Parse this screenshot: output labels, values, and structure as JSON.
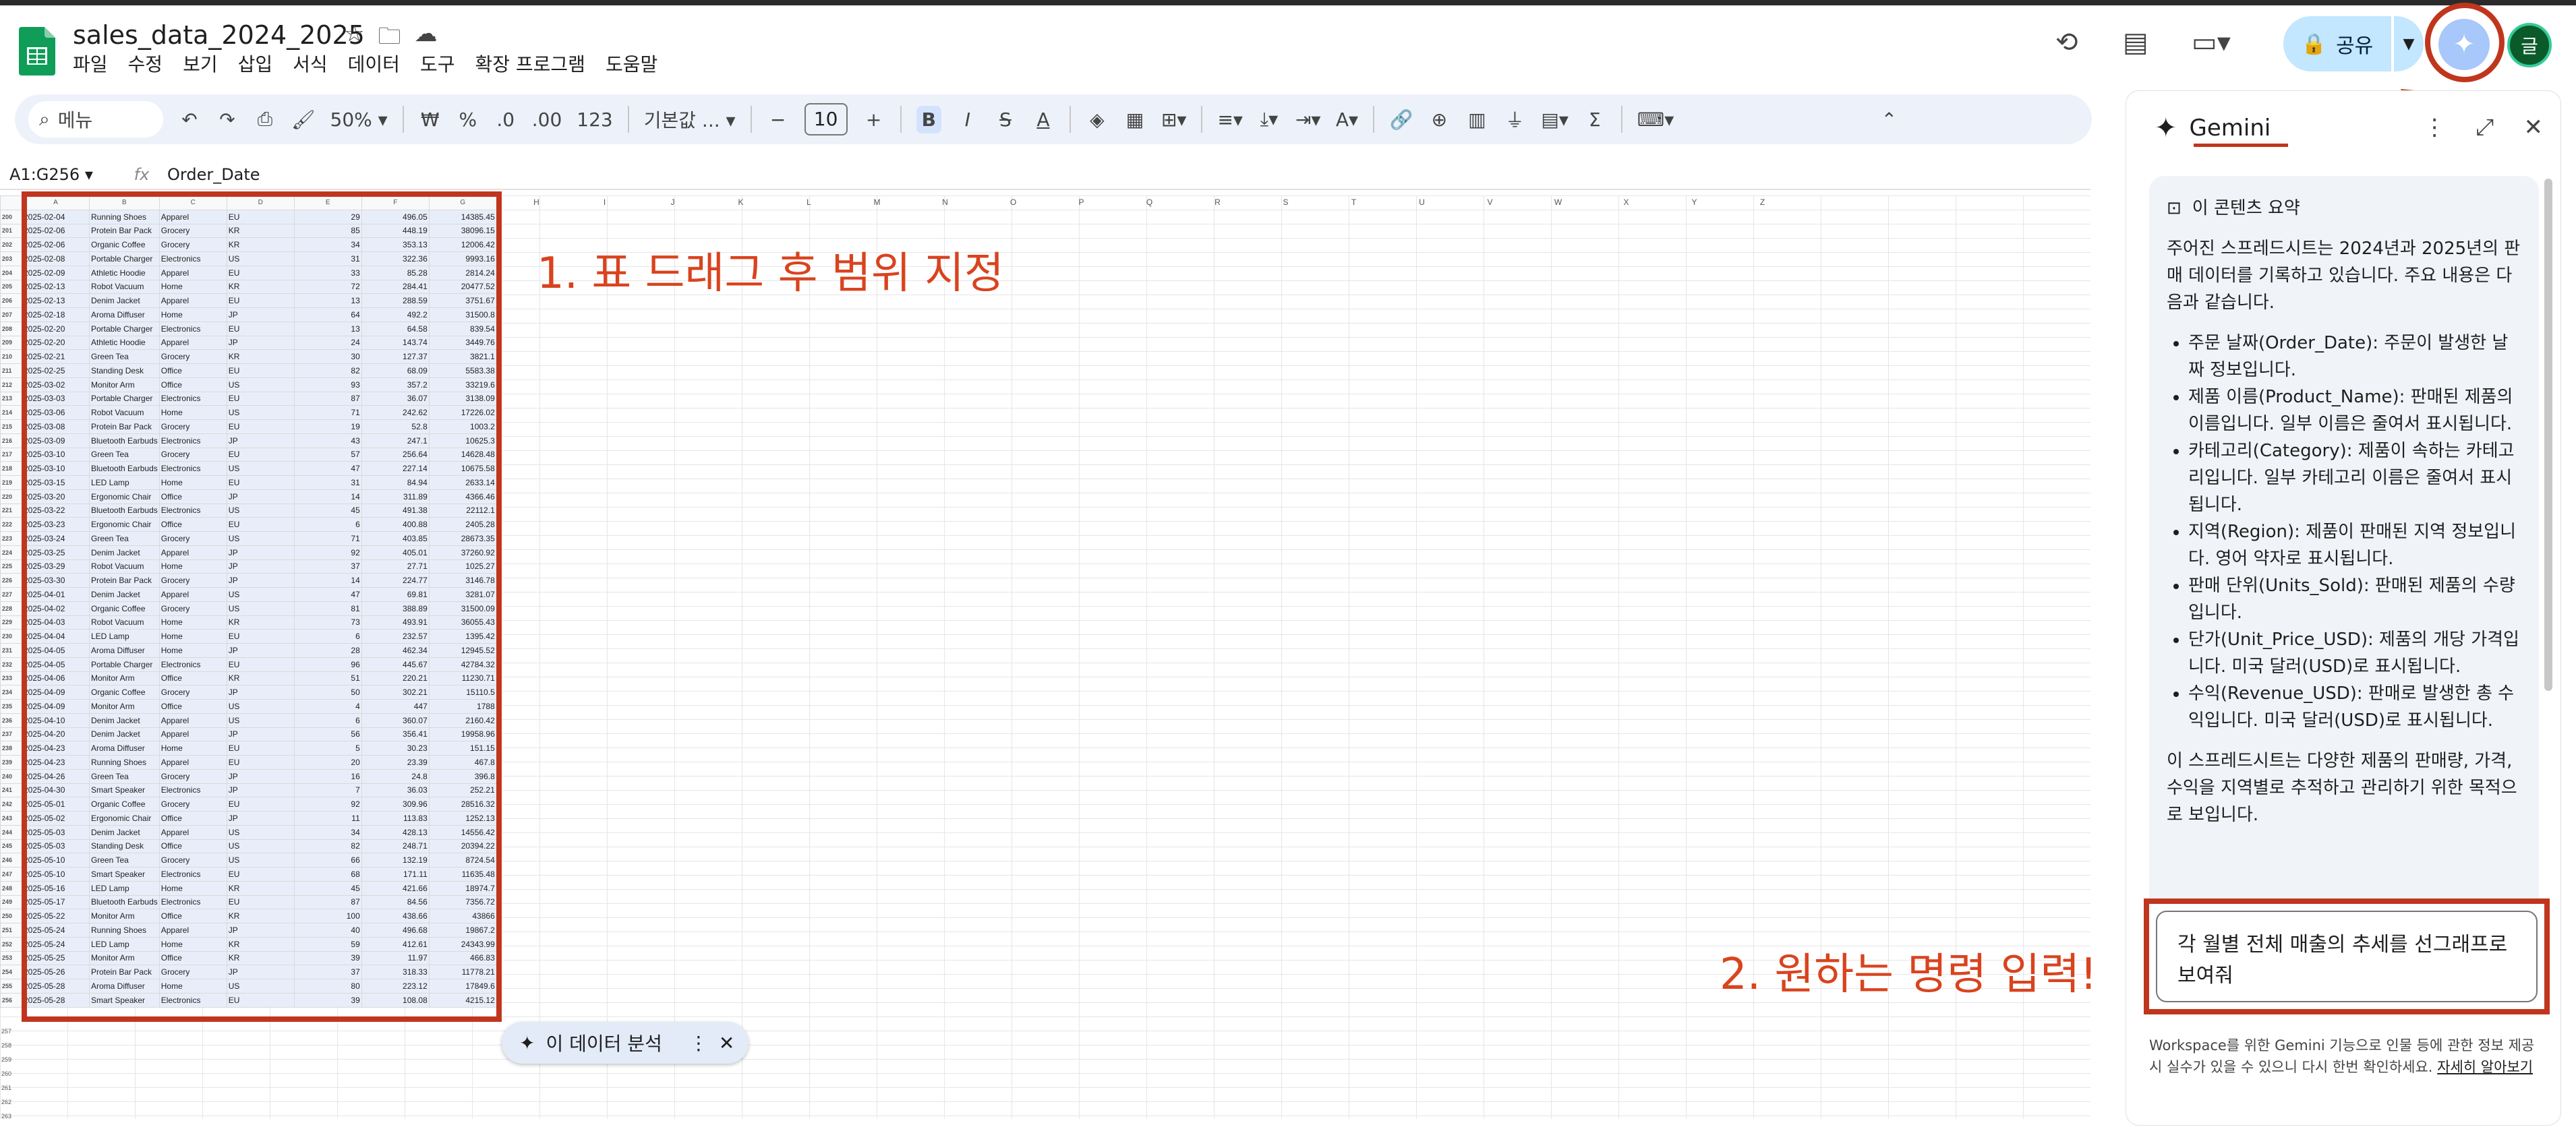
{
  "doc": {
    "title": "sales_data_2024_2025"
  },
  "menu": [
    "파일",
    "수정",
    "보기",
    "삽입",
    "서식",
    "데이터",
    "도구",
    "확장 프로그램",
    "도움말"
  ],
  "header": {
    "share_label": "공유",
    "avatar_letter": "글"
  },
  "toolbar": {
    "search_placeholder": "메뉴",
    "zoom": "50%",
    "currency": "₩",
    "percent": "%",
    "dec_less": ".0",
    "dec_more": ".00",
    "number_fmt": "123",
    "font": "기본값 ...",
    "font_size": "10",
    "minus": "−",
    "plus": "+",
    "bold": "B",
    "italic": "I",
    "strike": "S",
    "textcolor": "A"
  },
  "formula": {
    "range": "A1:G256",
    "fx": "fx",
    "value": "Order_Date"
  },
  "columns": [
    "A",
    "B",
    "C",
    "D",
    "E",
    "F",
    "G"
  ],
  "empty_columns": [
    "H",
    "I",
    "J",
    "K",
    "L",
    "M",
    "N",
    "O",
    "P",
    "Q",
    "R",
    "S",
    "T",
    "U",
    "V",
    "W",
    "X",
    "Y",
    "Z"
  ],
  "rows": [
    [
      "200",
      "2025-02-04",
      "Running Shoes",
      "Apparel",
      "EU",
      "29",
      "496.05",
      "14385.45"
    ],
    [
      "201",
      "2025-02-06",
      "Protein Bar Pack",
      "Grocery",
      "KR",
      "85",
      "448.19",
      "38096.15"
    ],
    [
      "202",
      "2025-02-06",
      "Organic Coffee",
      "Grocery",
      "KR",
      "34",
      "353.13",
      "12006.42"
    ],
    [
      "203",
      "2025-02-08",
      "Portable Charger",
      "Electronics",
      "US",
      "31",
      "322.36",
      "9993.16"
    ],
    [
      "204",
      "2025-02-09",
      "Athletic Hoodie",
      "Apparel",
      "EU",
      "33",
      "85.28",
      "2814.24"
    ],
    [
      "205",
      "2025-02-13",
      "Robot Vacuum",
      "Home",
      "KR",
      "72",
      "284.41",
      "20477.52"
    ],
    [
      "206",
      "2025-02-13",
      "Denim Jacket",
      "Apparel",
      "EU",
      "13",
      "288.59",
      "3751.67"
    ],
    [
      "207",
      "2025-02-18",
      "Aroma Diffuser",
      "Home",
      "JP",
      "64",
      "492.2",
      "31500.8"
    ],
    [
      "208",
      "2025-02-20",
      "Portable Charger",
      "Electronics",
      "EU",
      "13",
      "64.58",
      "839.54"
    ],
    [
      "209",
      "2025-02-20",
      "Athletic Hoodie",
      "Apparel",
      "JP",
      "24",
      "143.74",
      "3449.76"
    ],
    [
      "210",
      "2025-02-21",
      "Green Tea",
      "Grocery",
      "KR",
      "30",
      "127.37",
      "3821.1"
    ],
    [
      "211",
      "2025-02-25",
      "Standing Desk",
      "Office",
      "EU",
      "82",
      "68.09",
      "5583.38"
    ],
    [
      "212",
      "2025-03-02",
      "Monitor Arm",
      "Office",
      "US",
      "93",
      "357.2",
      "33219.6"
    ],
    [
      "213",
      "2025-03-03",
      "Portable Charger",
      "Electronics",
      "EU",
      "87",
      "36.07",
      "3138.09"
    ],
    [
      "214",
      "2025-03-06",
      "Robot Vacuum",
      "Home",
      "US",
      "71",
      "242.62",
      "17226.02"
    ],
    [
      "215",
      "2025-03-08",
      "Protein Bar Pack",
      "Grocery",
      "EU",
      "19",
      "52.8",
      "1003.2"
    ],
    [
      "216",
      "2025-03-09",
      "Bluetooth Earbuds",
      "Electronics",
      "JP",
      "43",
      "247.1",
      "10625.3"
    ],
    [
      "217",
      "2025-03-10",
      "Green Tea",
      "Grocery",
      "EU",
      "57",
      "256.64",
      "14628.48"
    ],
    [
      "218",
      "2025-03-10",
      "Bluetooth Earbuds",
      "Electronics",
      "US",
      "47",
      "227.14",
      "10675.58"
    ],
    [
      "219",
      "2025-03-15",
      "LED Lamp",
      "Home",
      "EU",
      "31",
      "84.94",
      "2633.14"
    ],
    [
      "220",
      "2025-03-20",
      "Ergonomic Chair",
      "Office",
      "JP",
      "14",
      "311.89",
      "4366.46"
    ],
    [
      "221",
      "2025-03-22",
      "Bluetooth Earbuds",
      "Electronics",
      "US",
      "45",
      "491.38",
      "22112.1"
    ],
    [
      "222",
      "2025-03-23",
      "Ergonomic Chair",
      "Office",
      "EU",
      "6",
      "400.88",
      "2405.28"
    ],
    [
      "223",
      "2025-03-24",
      "Green Tea",
      "Grocery",
      "US",
      "71",
      "403.85",
      "28673.35"
    ],
    [
      "224",
      "2025-03-25",
      "Denim Jacket",
      "Apparel",
      "JP",
      "92",
      "405.01",
      "37260.92"
    ],
    [
      "225",
      "2025-03-29",
      "Robot Vacuum",
      "Home",
      "JP",
      "37",
      "27.71",
      "1025.27"
    ],
    [
      "226",
      "2025-03-30",
      "Protein Bar Pack",
      "Grocery",
      "JP",
      "14",
      "224.77",
      "3146.78"
    ],
    [
      "227",
      "2025-04-01",
      "Denim Jacket",
      "Apparel",
      "US",
      "47",
      "69.81",
      "3281.07"
    ],
    [
      "228",
      "2025-04-02",
      "Organic Coffee",
      "Grocery",
      "US",
      "81",
      "388.89",
      "31500.09"
    ],
    [
      "229",
      "2025-04-03",
      "Robot Vacuum",
      "Home",
      "KR",
      "73",
      "493.91",
      "36055.43"
    ],
    [
      "230",
      "2025-04-04",
      "LED Lamp",
      "Home",
      "EU",
      "6",
      "232.57",
      "1395.42"
    ],
    [
      "231",
      "2025-04-05",
      "Aroma Diffuser",
      "Home",
      "JP",
      "28",
      "462.34",
      "12945.52"
    ],
    [
      "232",
      "2025-04-05",
      "Portable Charger",
      "Electronics",
      "EU",
      "96",
      "445.67",
      "42784.32"
    ],
    [
      "233",
      "2025-04-06",
      "Monitor Arm",
      "Office",
      "KR",
      "51",
      "220.21",
      "11230.71"
    ],
    [
      "234",
      "2025-04-09",
      "Organic Coffee",
      "Grocery",
      "JP",
      "50",
      "302.21",
      "15110.5"
    ],
    [
      "235",
      "2025-04-09",
      "Monitor Arm",
      "Office",
      "US",
      "4",
      "447",
      "1788"
    ],
    [
      "236",
      "2025-04-10",
      "Denim Jacket",
      "Apparel",
      "US",
      "6",
      "360.07",
      "2160.42"
    ],
    [
      "237",
      "2025-04-20",
      "Denim Jacket",
      "Apparel",
      "JP",
      "56",
      "356.41",
      "19958.96"
    ],
    [
      "238",
      "2025-04-23",
      "Aroma Diffuser",
      "Home",
      "EU",
      "5",
      "30.23",
      "151.15"
    ],
    [
      "239",
      "2025-04-23",
      "Running Shoes",
      "Apparel",
      "EU",
      "20",
      "23.39",
      "467.8"
    ],
    [
      "240",
      "2025-04-26",
      "Green Tea",
      "Grocery",
      "JP",
      "16",
      "24.8",
      "396.8"
    ],
    [
      "241",
      "2025-04-30",
      "Smart Speaker",
      "Electronics",
      "JP",
      "7",
      "36.03",
      "252.21"
    ],
    [
      "242",
      "2025-05-01",
      "Organic Coffee",
      "Grocery",
      "EU",
      "92",
      "309.96",
      "28516.32"
    ],
    [
      "243",
      "2025-05-02",
      "Ergonomic Chair",
      "Office",
      "JP",
      "11",
      "113.83",
      "1252.13"
    ],
    [
      "244",
      "2025-05-03",
      "Denim Jacket",
      "Apparel",
      "US",
      "34",
      "428.13",
      "14556.42"
    ],
    [
      "245",
      "2025-05-03",
      "Standing Desk",
      "Office",
      "US",
      "82",
      "248.71",
      "20394.22"
    ],
    [
      "246",
      "2025-05-10",
      "Green Tea",
      "Grocery",
      "US",
      "66",
      "132.19",
      "8724.54"
    ],
    [
      "247",
      "2025-05-10",
      "Smart Speaker",
      "Electronics",
      "EU",
      "68",
      "171.11",
      "11635.48"
    ],
    [
      "248",
      "2025-05-16",
      "LED Lamp",
      "Home",
      "KR",
      "45",
      "421.66",
      "18974.7"
    ],
    [
      "249",
      "2025-05-17",
      "Bluetooth Earbuds",
      "Electronics",
      "EU",
      "87",
      "84.56",
      "7356.72"
    ],
    [
      "250",
      "2025-05-22",
      "Monitor Arm",
      "Office",
      "KR",
      "100",
      "438.66",
      "43866"
    ],
    [
      "251",
      "2025-05-24",
      "Running Shoes",
      "Apparel",
      "JP",
      "40",
      "496.68",
      "19867.2"
    ],
    [
      "252",
      "2025-05-24",
      "LED Lamp",
      "Home",
      "KR",
      "59",
      "412.61",
      "24343.99"
    ],
    [
      "253",
      "2025-05-25",
      "Monitor Arm",
      "Office",
      "KR",
      "39",
      "11.97",
      "466.83"
    ],
    [
      "254",
      "2025-05-26",
      "Protein Bar Pack",
      "Grocery",
      "JP",
      "37",
      "318.33",
      "11778.21"
    ],
    [
      "255",
      "2025-05-28",
      "Aroma Diffuser",
      "Home",
      "US",
      "80",
      "223.12",
      "17849.6"
    ],
    [
      "256",
      "2025-05-28",
      "Smart Speaker",
      "Electronics",
      "EU",
      "39",
      "108.08",
      "4215.12"
    ]
  ],
  "empty_row_numbers": [
    "257",
    "258",
    "259",
    "260",
    "261",
    "262",
    "263"
  ],
  "annotations": {
    "step1": "1. 표 드래그 후 범위 지정",
    "step2": "2. 원하는 명령 입력!"
  },
  "chip": {
    "label": "이 데이터 분석"
  },
  "gemini": {
    "title": "Gemini",
    "summary_heading": "이 콘텐츠 요약",
    "intro": "주어진 스프레드시트는 2024년과 2025년의 판매 데이터를 기록하고 있습니다. 주요 내용은 다음과 같습니다.",
    "bullets": [
      "주문 날짜(Order_Date): 주문이 발생한 날짜 정보입니다.",
      "제품 이름(Product_Name): 판매된 제품의 이름입니다. 일부 이름은 줄여서 표시됩니다.",
      "카테고리(Category): 제품이 속하는 카테고리입니다. 일부 카테고리 이름은 줄여서 표시됩니다.",
      "지역(Region): 제품이 판매된 지역 정보입니다. 영어 약자로 표시됩니다.",
      "판매 단위(Units_Sold): 판매된 제품의 수량입니다.",
      "단가(Unit_Price_USD): 제품의 개당 가격입니다. 미국 달러(USD)로 표시됩니다.",
      "수익(Revenue_USD): 판매로 발생한 총 수익입니다. 미국 달러(USD)로 표시됩니다."
    ],
    "conclusion": "이 스프레드시트는 다양한 제품의 판매량, 가격, 수익을 지역별로 추적하고 관리하기 위한 목적으로 보입니다.",
    "prompt": "각 월별 전체 매출의 추세를 선그래프로 보여줘",
    "disclaimer": "Workspace를 위한 Gemini 기능으로 인물 등에 관한 정보 제공 시 실수가 있을 수 있으니 다시 한번 확인하세요.",
    "learn_more": "자세히 알아보기"
  }
}
